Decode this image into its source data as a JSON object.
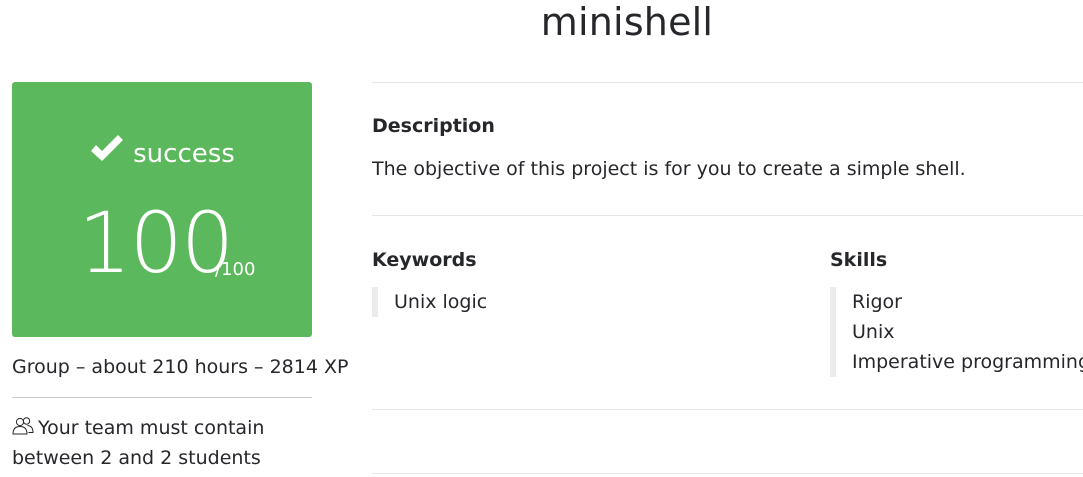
{
  "project": {
    "title": "minishell"
  },
  "status_card": {
    "status": "success",
    "score": "100",
    "max_score": "/100",
    "color": "#5cb85c"
  },
  "meta": {
    "info": "Group – about 210 hours – 2814 XP",
    "team": "Your team must contain between 2 and 2 students",
    "team_icon": "users-icon"
  },
  "description": {
    "label": "Description",
    "text": "The objective of this project is for you to create a simple shell."
  },
  "keywords": {
    "label": "Keywords",
    "items": [
      "Unix logic"
    ]
  },
  "skills": {
    "label": "Skills",
    "items": [
      "Rigor",
      "Unix",
      "Imperative programming"
    ]
  }
}
